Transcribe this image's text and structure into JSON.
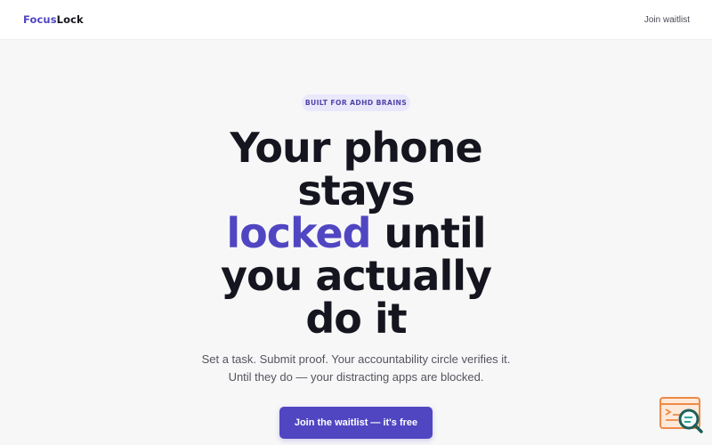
{
  "nav": {
    "logo_part1": "Focus",
    "logo_part2": "Lock",
    "join_link": "Join waitlist"
  },
  "hero": {
    "badge": "BUILT FOR ADHD BRAINS",
    "headline": {
      "line1": "Your phone",
      "line2": "stays",
      "line3_accent": "locked",
      "line3_rest": " until",
      "line4": "you actually",
      "line5": "do it"
    },
    "subtitle": {
      "line1": "Set a task. Submit proof. Your accountability circle verifies it.",
      "line2": "Until they do — your distracting apps are blocked."
    },
    "cta_label": "Join the waitlist — it's free"
  },
  "colors": {
    "accent": "#5046c2",
    "text": "#15151f",
    "badge_bg": "#eae8fb",
    "background": "#f7f7f8"
  },
  "widget": {
    "icon": "search-code-icon"
  }
}
